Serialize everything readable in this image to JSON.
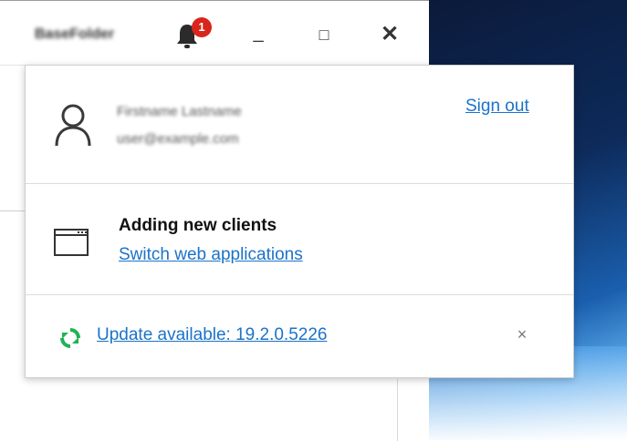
{
  "window": {
    "app_title": "BaseFolder",
    "notification_count": "1",
    "minimize_label": "_",
    "maximize_label": "□",
    "close_label": "✕"
  },
  "account": {
    "name": "Firstname Lastname",
    "email": "user@example.com",
    "sign_out_label": "Sign out"
  },
  "clients": {
    "title": "Adding new clients",
    "switch_label": "Switch web applications"
  },
  "update": {
    "label": "Update available: 19.2.0.5226",
    "dismiss_label": "×"
  },
  "colors": {
    "link": "#1a73c9",
    "badge": "#d9261c",
    "update_icon": "#1fb356"
  },
  "icons": [
    "bell-icon",
    "user-icon",
    "app-window-icon",
    "refresh-icon",
    "close-icon"
  ]
}
